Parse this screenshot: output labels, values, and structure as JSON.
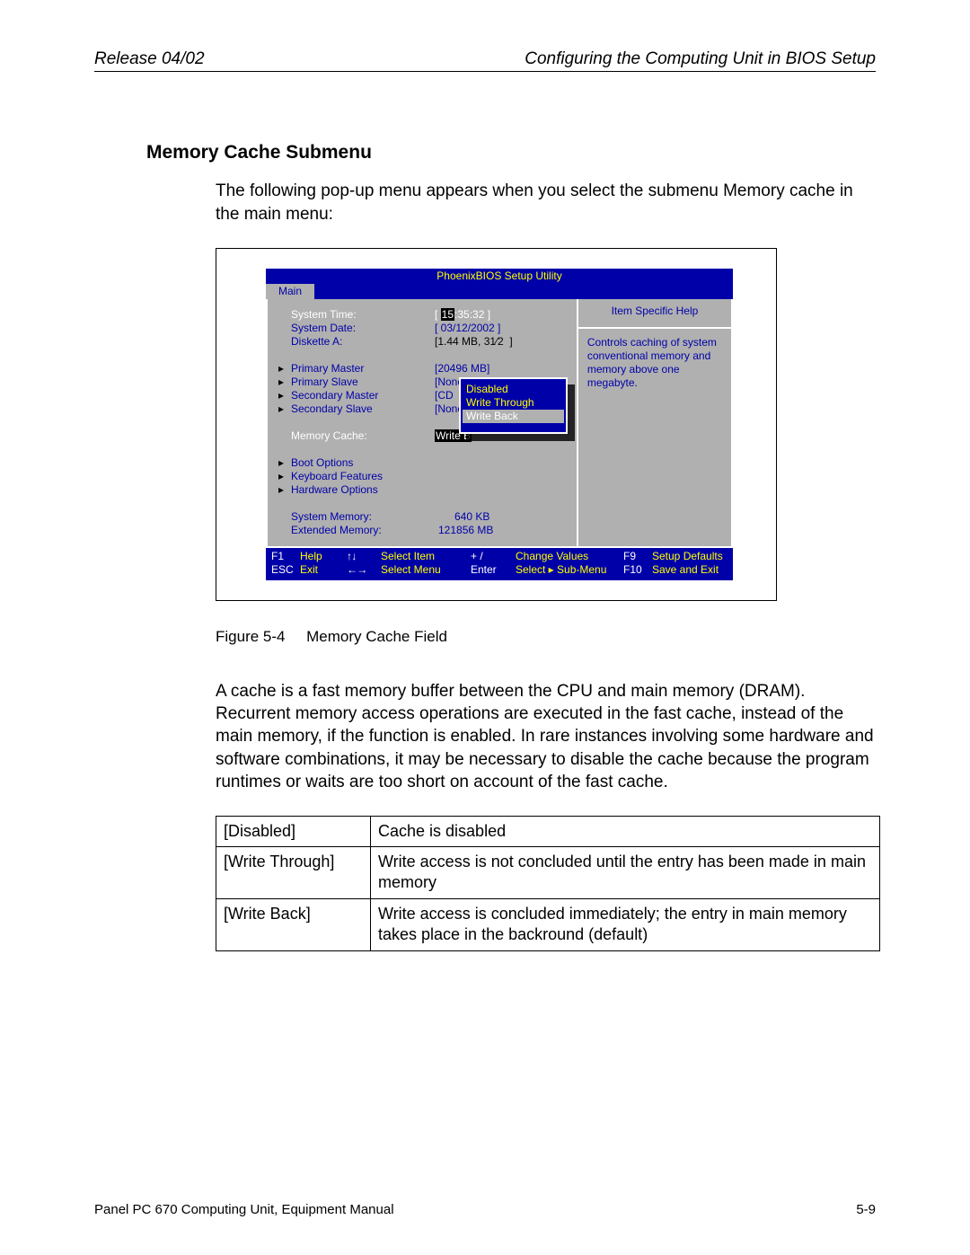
{
  "header": {
    "release": "Release 04/02",
    "chapter": "Configuring the Computing Unit in BIOS Setup"
  },
  "section_title": "Memory Cache  Submenu",
  "intro": "The following pop-up menu appears when you select the submenu  Memory cache  in the main menu:",
  "bios": {
    "title": "PhoenixBIOS Setup Utility",
    "tab": "Main",
    "help_heading": "Item Specific Help",
    "help_text": "Controls caching of system conventional memory and memory above one megabyte.",
    "rows": {
      "system_time_label": "System Time:",
      "system_time_value_prefix": "[ ",
      "system_time_hh": "15",
      "system_time_rest": ":35:32 ]",
      "system_date_label": "System Date:",
      "system_date_value": "[ 03/12/2002 ]",
      "diskette_label": "Diskette A:",
      "diskette_value": "[1.44 MB, 31⁄2  ]",
      "primary_master": "Primary Master",
      "primary_master_val": "[20496 MB]",
      "primary_slave": "Primary Slave",
      "primary_slave_val": "[None]",
      "secondary_master": "Secondary Master",
      "secondary_master_val": "[CD  RO",
      "secondary_slave": "Secondary Slave",
      "secondary_slave_val": "[None]",
      "memory_cache_label": "Memory Cache:",
      "memory_cache_val": "Write B",
      "boot_options": "Boot Options",
      "keyboard_features": "Keyboard Features",
      "hardware_options": "Hardware Options",
      "system_memory_label": "System Memory:",
      "system_memory_val": "640 KB",
      "extended_memory_label": "Extended Memory:",
      "extended_memory_val": "121856 MB"
    },
    "popup": {
      "opt1": "Disabled",
      "opt2": "Write Through",
      "opt3": "Write Back"
    },
    "footer": {
      "f1": "F1",
      "help": "Help",
      "esc": "ESC",
      "exit": "Exit",
      "arrows_v": "↑ ↓",
      "select_item": "Select Item",
      "arrows_h": "← →",
      "select_menu": "Select Menu",
      "plusminus": "+ /",
      "change_values": "Change Values",
      "enter": "Enter",
      "select_sub": "Select ▸ Sub-Menu",
      "f9": "F9",
      "setup_defaults": "Setup Defaults",
      "f10": "F10",
      "save_exit": "Save and Exit"
    }
  },
  "caption_label": "Figure 5-4",
  "caption_text": "Memory Cache  Field",
  "body_para": "A cache is a fast memory buffer between the CPU and main memory (DRAM). Recurrent memory access operations are executed in the fast cache, instead of the main memory, if the function is enabled. In rare instances involving some hardware and software combinations, it may be necessary to disable the cache because the program runtimes or waits are too short on account of the fast cache.",
  "table": {
    "r1c1": "[Disabled]",
    "r1c2": "Cache is disabled",
    "r2c1": "[Write Through]",
    "r2c2": "Write access is not concluded until the entry has been made in main memory",
    "r3c1": "[Write Back]",
    "r3c2": "Write access is concluded immediately; the entry in main memory takes place in the backround (default)"
  },
  "footer": {
    "manual": "Panel PC 670 Computing Unit, Equipment Manual",
    "page": "5-9"
  }
}
